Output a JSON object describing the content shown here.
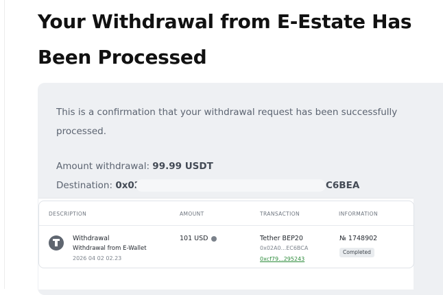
{
  "email": {
    "title": "Your Withdrawal from E-Estate Has Been Processed",
    "confirmation": "This is a confirmation that your withdrawal request has been successfully processed.",
    "amount_label": "Amount withdrawal:",
    "amount_value": "99.99 USDT",
    "destination_label": "Destination:",
    "destination_prefix": "0x02A",
    "destination_suffix": "C6BEA"
  },
  "table": {
    "headers": [
      "DESCRIPTION",
      "AMOUNT",
      "TRANSACTION",
      "INFORMATION"
    ],
    "row": {
      "title": "Withdrawal",
      "subtitle": "Withdrawal from E-Wallet",
      "datetime": "2026 04 02 02.23",
      "amount": "101 USD",
      "tx_network": "Tether BEP20",
      "tx_address": "0x02A0...EC6BCA",
      "tx_hash": "0xcf79...295243",
      "info_number": "№ 1748902",
      "status": "Completed"
    }
  },
  "colors": {
    "card_bg": "#eef0f3",
    "status_badge": "#e9ecef",
    "link": "#2c8b3a"
  },
  "icons": [
    "wallet-icon",
    "info-icon"
  ]
}
